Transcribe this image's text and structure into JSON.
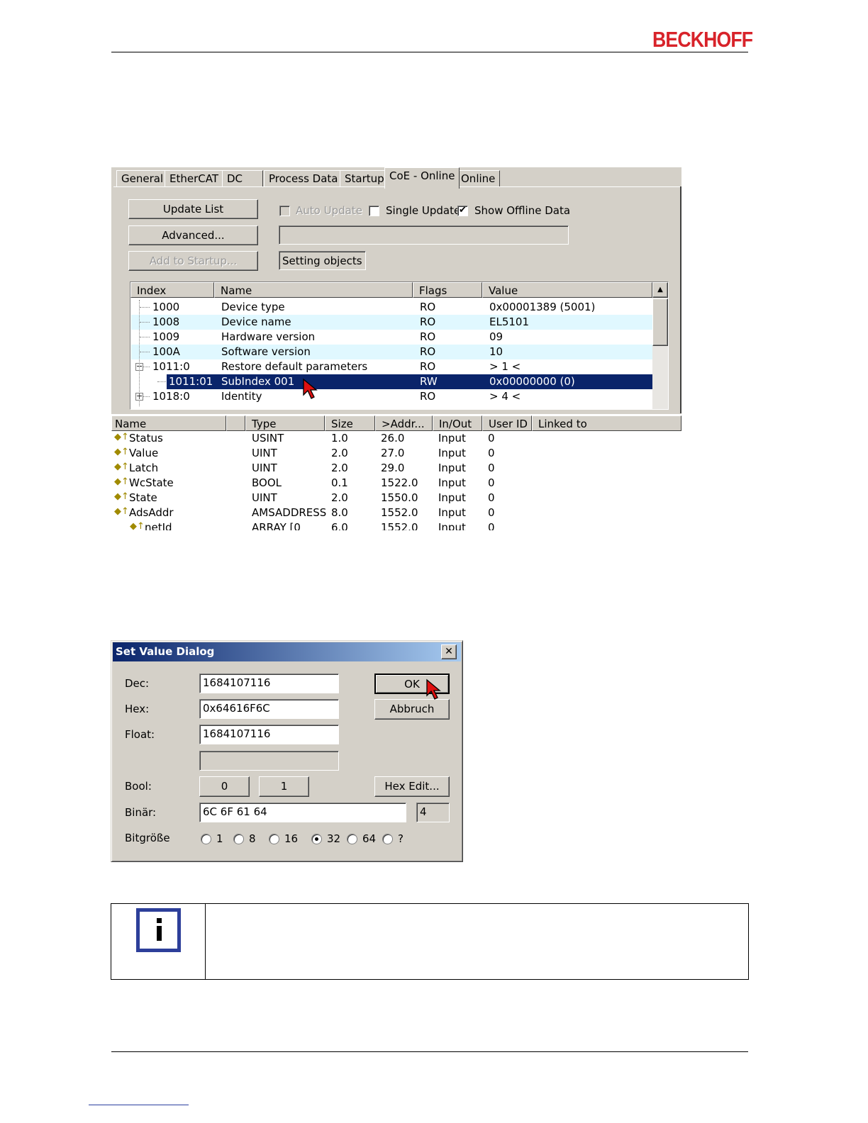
{
  "header": {
    "brand": "BECKHOFF"
  },
  "coe_window": {
    "tabs": [
      {
        "label": "General"
      },
      {
        "label": "EtherCAT"
      },
      {
        "label": "DC"
      },
      {
        "label": "Process Data"
      },
      {
        "label": "Startup"
      },
      {
        "label": "CoE - Online"
      },
      {
        "label": "Online"
      }
    ],
    "active_tab": "CoE - Online",
    "buttons": {
      "update_list": "Update List",
      "advanced": "Advanced...",
      "add_to_startup": "Add to Startup..."
    },
    "checkboxes": {
      "auto_update": {
        "label": "Auto Update",
        "checked": false,
        "disabled": true
      },
      "single_update": {
        "label": "Single Update",
        "checked": false
      },
      "show_offline": {
        "label": "Show Offline Data",
        "checked": true
      }
    },
    "status_text": "Setting objects",
    "columns": [
      "Index",
      "Name",
      "Flags",
      "Value"
    ],
    "rows": [
      {
        "index": "1000",
        "name": "Device type",
        "flags": "RO",
        "value": "0x00001389 (5001)"
      },
      {
        "index": "1008",
        "name": "Device name",
        "flags": "RO",
        "value": "EL5101"
      },
      {
        "index": "1009",
        "name": "Hardware version",
        "flags": "RO",
        "value": "09"
      },
      {
        "index": "100A",
        "name": "Software version",
        "flags": "RO",
        "value": "10"
      },
      {
        "index": "1011:0",
        "name": "Restore default parameters",
        "flags": "RO",
        "value": "> 1 <"
      },
      {
        "index": "1011:01",
        "name": "SubIndex 001",
        "flags": "RW",
        "value": "0x00000000 (0)"
      },
      {
        "index": "1018:0",
        "name": "Identity",
        "flags": "RO",
        "value": "> 4 <"
      }
    ]
  },
  "vars_window": {
    "columns": [
      "Name",
      "",
      "Type",
      "Size",
      ">Addr...",
      "In/Out",
      "User ID",
      "Linked to"
    ],
    "rows": [
      {
        "name": "Status",
        "type": "USINT",
        "size": "1.0",
        "addr": "26.0",
        "inout": "Input",
        "userid": "0"
      },
      {
        "name": "Value",
        "type": "UINT",
        "size": "2.0",
        "addr": "27.0",
        "inout": "Input",
        "userid": "0"
      },
      {
        "name": "Latch",
        "type": "UINT",
        "size": "2.0",
        "addr": "29.0",
        "inout": "Input",
        "userid": "0"
      },
      {
        "name": "WcState",
        "type": "BOOL",
        "size": "0.1",
        "addr": "1522.0",
        "inout": "Input",
        "userid": "0"
      },
      {
        "name": "State",
        "type": "UINT",
        "size": "2.0",
        "addr": "1550.0",
        "inout": "Input",
        "userid": "0"
      },
      {
        "name": "AdsAddr",
        "type": "AMSADDRESS",
        "size": "8.0",
        "addr": "1552.0",
        "inout": "Input",
        "userid": "0"
      },
      {
        "name": "netId",
        "type": "ARRAY [0",
        "size": "6.0",
        "addr": "1552.0",
        "inout": "Input",
        "userid": "0"
      }
    ]
  },
  "dialog": {
    "title": "Set Value Dialog",
    "labels": {
      "dec": "Dec:",
      "hex": "Hex:",
      "float": "Float:",
      "bool": "Bool:",
      "binar": "Binär:",
      "bitsize": "Bitgröße"
    },
    "values": {
      "dec": "1684107116",
      "hex": "0x64616F6C",
      "float": "1684107116",
      "empty": "",
      "binar": "6C 6F 61 64",
      "binar_len": "4"
    },
    "buttons": {
      "ok": "OK",
      "cancel": "Abbruch",
      "bool0": "0",
      "bool1": "1",
      "hex_edit": "Hex Edit..."
    },
    "bitsizes": [
      {
        "label": "1",
        "checked": false
      },
      {
        "label": "8",
        "checked": false
      },
      {
        "label": "16",
        "checked": false
      },
      {
        "label": "32",
        "checked": true
      },
      {
        "label": "64",
        "checked": false
      },
      {
        "label": "?",
        "checked": false
      }
    ]
  }
}
